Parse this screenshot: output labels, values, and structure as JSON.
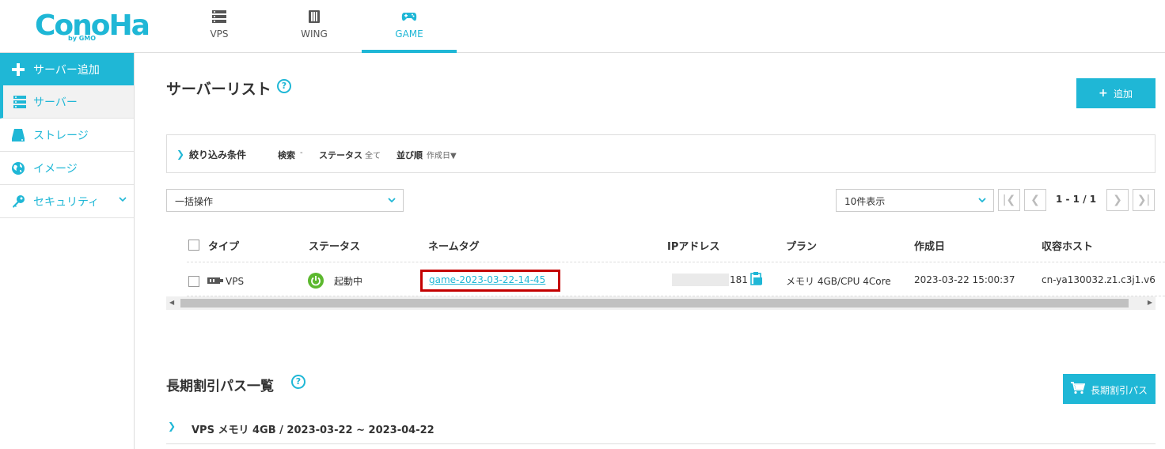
{
  "brand": {
    "logo_text": "ConoHa",
    "logo_sub": "by GMO"
  },
  "nav": {
    "tabs": [
      {
        "label": "VPS",
        "icon": "server-rack-icon"
      },
      {
        "label": "WING",
        "icon": "wing-server-icon"
      },
      {
        "label": "GAME",
        "icon": "gamepad-icon",
        "active": true
      }
    ]
  },
  "sidebar": {
    "items": [
      {
        "label": "サーバー追加",
        "icon": "plus-icon"
      },
      {
        "label": "サーバー",
        "icon": "server-icon",
        "selected": true
      },
      {
        "label": "ストレージ",
        "icon": "storage-icon"
      },
      {
        "label": "イメージ",
        "icon": "globe-icon"
      },
      {
        "label": "セキュリティ",
        "icon": "key-icon",
        "has_chevron": true
      }
    ]
  },
  "main": {
    "title": "サーバーリスト",
    "help": "?",
    "add_button": {
      "plus": "+",
      "label": "追加"
    },
    "filter": {
      "chevron": "❯",
      "title": "絞り込み条件",
      "search_key": "検索",
      "search_value": "-",
      "status_key": "ステータス",
      "status_value": "全て",
      "sort_key": "並び順",
      "sort_value": "作成日▼"
    },
    "bulk_select": "一括操作",
    "per_page_select": "10件表示",
    "pagination": {
      "info": "1 - 1 / 1",
      "first": "|❮",
      "prev": "❮",
      "next": "❯",
      "last": "❯|"
    },
    "table": {
      "headers": [
        "タイプ",
        "ステータス",
        "ネームタグ",
        "IPアドレス",
        "プラン",
        "作成日",
        "収容ホスト"
      ],
      "rows": [
        {
          "type": "VPS",
          "status": "起動中",
          "nametag": "game-2023-03-22-14-45",
          "ip_suffix": "181",
          "plan": "メモリ 4GB/CPU 4Core",
          "created": "2023-03-22 15:00:37",
          "host": "cn-ya130032.z1.c3j1.v6"
        }
      ]
    }
  },
  "pass_section": {
    "title": "長期割引パス一覧",
    "help": "?",
    "button_label": "長期割引パス",
    "rows": [
      {
        "chevron": "❯",
        "label": "VPS メモリ 4GB / 2023-03-22 ~ 2023-04-22"
      }
    ]
  },
  "colors": {
    "accent": "#1fb7d6",
    "status_running": "#5cb82e",
    "highlight_box": "#c40000"
  }
}
